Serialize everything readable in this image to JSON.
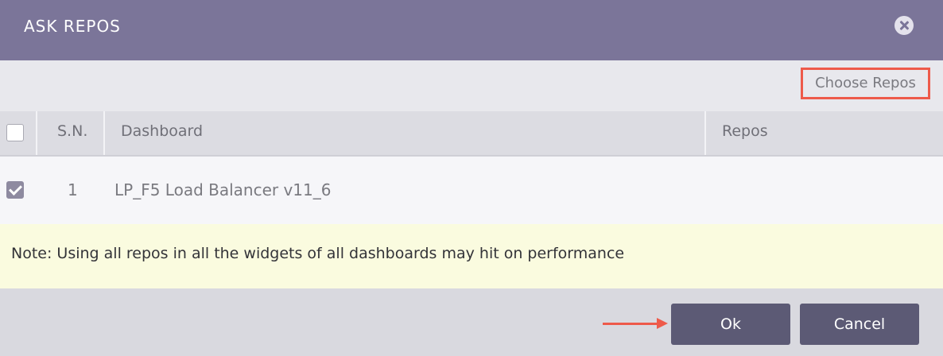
{
  "dialog": {
    "title": "ASK REPOS",
    "close_icon": "close-icon"
  },
  "toolbar": {
    "choose_repos_label": "Choose Repos"
  },
  "table": {
    "columns": [
      "S.N.",
      "Dashboard",
      "Repos"
    ],
    "select_all_checked": false,
    "rows": [
      {
        "checked": true,
        "sn": "1",
        "dashboard": "LP_F5 Load Balancer v11_6",
        "repos": ""
      }
    ]
  },
  "note": {
    "text": "Note: Using all repos in all the widgets of all dashboards may hit on performance"
  },
  "footer": {
    "ok_label": "Ok",
    "cancel_label": "Cancel"
  },
  "colors": {
    "header_bg": "#7b7599",
    "button_bg": "#5c5a75",
    "highlight": "#ee5a4a",
    "note_bg": "#fafbdf"
  }
}
